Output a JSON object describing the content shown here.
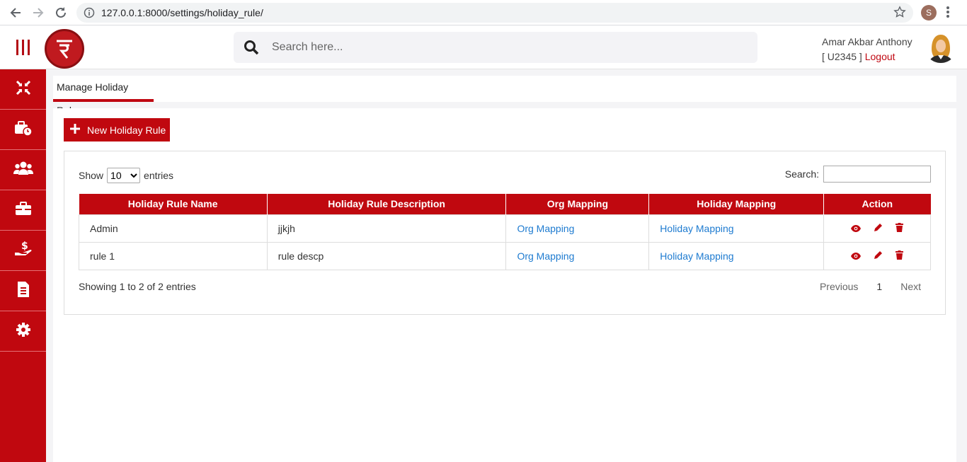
{
  "browser": {
    "url": "127.0.0.1:8000/settings/holiday_rule/",
    "profile_initial": "S"
  },
  "header": {
    "search_placeholder": "Search here...",
    "user_name": "Amar Akbar Anthony",
    "user_code": "[ U2345 ]",
    "logout_label": "Logout"
  },
  "sidebar": {
    "items": [
      {
        "icon": "compress-arrows-icon"
      },
      {
        "icon": "briefcase-clock-icon"
      },
      {
        "icon": "users-icon"
      },
      {
        "icon": "briefcase-icon"
      },
      {
        "icon": "hand-dollar-icon"
      },
      {
        "icon": "document-icon"
      },
      {
        "icon": "gear-icon"
      }
    ]
  },
  "main": {
    "tab_label": "Manage Holiday Rule",
    "new_button_label": "New Holiday Rule",
    "show_label": "Show",
    "entries_label": "entries",
    "page_size": "10",
    "search_label": "Search:",
    "columns": [
      "Holiday Rule Name",
      "Holiday Rule Description",
      "Org Mapping",
      "Holiday Mapping",
      "Action"
    ],
    "rows": [
      {
        "name": "Admin",
        "description": "jjkjh",
        "org": "Org Mapping",
        "holiday": "Holiday Mapping"
      },
      {
        "name": "rule 1",
        "description": "rule descp",
        "org": "Org Mapping",
        "holiday": "Holiday Mapping"
      }
    ],
    "info_text": "Showing 1 to 2 of 2 entries",
    "pager": {
      "previous": "Previous",
      "current": "1",
      "next": "Next"
    }
  },
  "colors": {
    "brand_red": "#c0080f",
    "link_blue": "#1e7bd0"
  }
}
